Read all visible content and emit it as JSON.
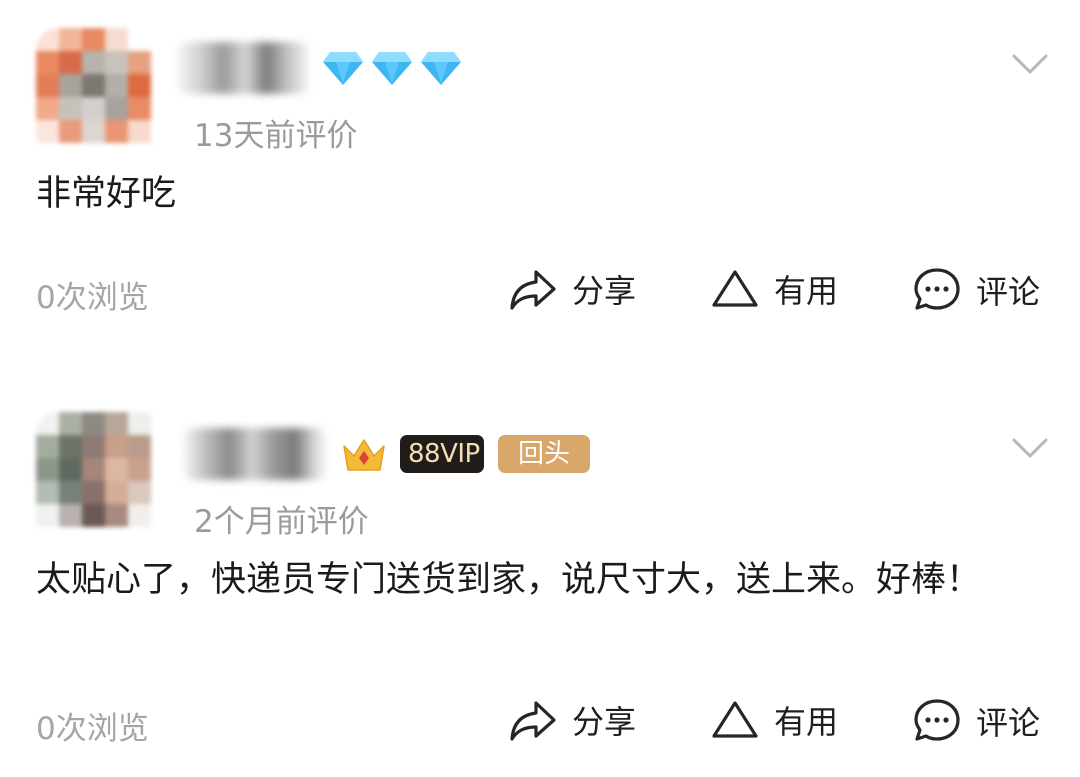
{
  "reviews": [
    {
      "time": "13天前评价",
      "content": "非常好吃",
      "views": "0次浏览",
      "badges": [],
      "actions": {
        "share": "分享",
        "useful": "有用",
        "comment": "评论"
      }
    },
    {
      "time": "2个月前评价",
      "content": "太贴心了，快递员专门送货到家，说尺寸大，送上来。好棒！",
      "views": "0次浏览",
      "badges": [
        "88VIP",
        "回头客"
      ],
      "actions": {
        "share": "分享",
        "useful": "有用",
        "comment": "评论"
      }
    }
  ],
  "icons": {
    "level": "diamond-icon",
    "member": "crown-icon",
    "expand": "chevron-down-icon",
    "share": "share-arrow-icon",
    "useful": "triangle-up-icon",
    "comment": "chat-bubble-icon"
  },
  "colors": {
    "diamond": "#3fb6f2",
    "vip_bg": "#1f1c1a",
    "vip_text": "#f4dcb4",
    "return_bg": "#d9a76a",
    "muted": "#9b9b9b"
  }
}
